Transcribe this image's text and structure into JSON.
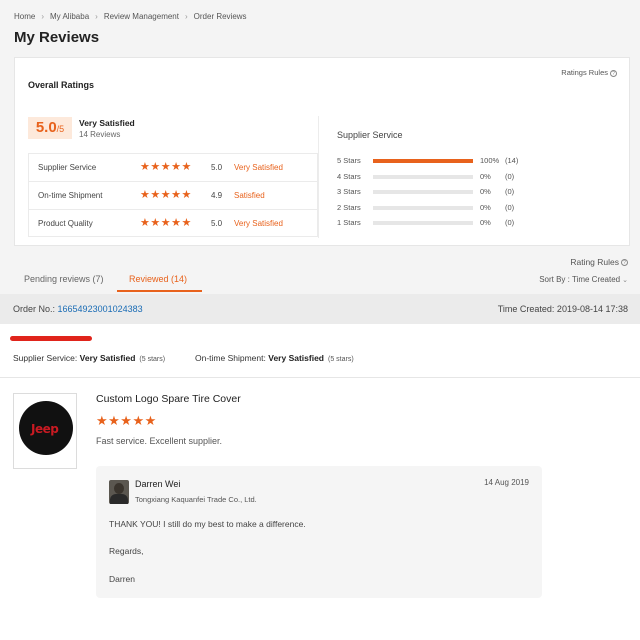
{
  "breadcrumb": [
    "Home",
    "My Alibaba",
    "Review Management",
    "Order Reviews"
  ],
  "page_title": "My Reviews",
  "overall": {
    "title": "Overall Ratings",
    "rating_rules": "Ratings Rules",
    "score": "5.0",
    "score_of": "/5",
    "label": "Very Satisfied",
    "count": "14 Reviews",
    "metrics": [
      {
        "name": "Supplier Service",
        "stars": "★★★★★",
        "score": "5.0",
        "text": "Very Satisfied"
      },
      {
        "name": "On-time Shipment",
        "stars": "★★★★★",
        "score": "4.9",
        "text": "Satisfied"
      },
      {
        "name": "Product Quality",
        "stars": "★★★★★",
        "score": "5.0",
        "text": "Very Satisfied"
      }
    ]
  },
  "supplier_service": {
    "title": "Supplier Service",
    "rows": [
      {
        "label": "5 Stars",
        "pct": "100%",
        "count": "(14)",
        "fill": 1.0
      },
      {
        "label": "4 Stars",
        "pct": "0%",
        "count": "(0)",
        "fill": 0
      },
      {
        "label": "3 Stars",
        "pct": "0%",
        "count": "(0)",
        "fill": 0
      },
      {
        "label": "2 Stars",
        "pct": "0%",
        "count": "(0)",
        "fill": 0
      },
      {
        "label": "1 Stars",
        "pct": "0%",
        "count": "(0)",
        "fill": 0
      }
    ]
  },
  "tabs": {
    "rating_rules": "Rating Rules",
    "pending": "Pending reviews (7)",
    "reviewed": "Reviewed (14)",
    "sort_by": "Sort By : Time Created"
  },
  "order": {
    "label": "Order No.:",
    "number": "16654923001024383",
    "time_created": "Time Created: 2019-08-14 17:38"
  },
  "service": {
    "supplier_label": "Supplier Service:",
    "supplier_value": "Very Satisfied",
    "supplier_stars": "(5 stars)",
    "shipment_label": "On-time Shipment:",
    "shipment_value": "Very Satisfied",
    "shipment_stars": "(5 stars)"
  },
  "review": {
    "product_title": "Custom Logo Spare Tire Cover",
    "logo_text": "Jeep",
    "stars": "★★★★★",
    "comment": "Fast service. Excellent supplier."
  },
  "reply": {
    "name": "Darren Wei",
    "company": "Tongxiang Kaquanfei Trade Co., Ltd.",
    "date": "14 Aug 2019",
    "line1": "THANK YOU! I still do my best to make a difference.",
    "line2": "Regards,",
    "line3": "Darren"
  },
  "colors": {
    "accent": "#e8621c",
    "link": "#1a6cb5",
    "redaction": "#e0241b"
  }
}
